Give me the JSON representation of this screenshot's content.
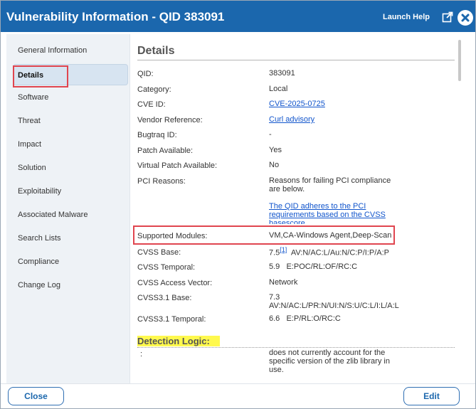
{
  "window": {
    "title": "Vulnerability Information - QID 383091",
    "launch_help": "Launch Help"
  },
  "sidebar": {
    "items": [
      {
        "label": "General Information"
      },
      {
        "label": "Details"
      },
      {
        "label": "Software"
      },
      {
        "label": "Threat"
      },
      {
        "label": "Impact"
      },
      {
        "label": "Solution"
      },
      {
        "label": "Exploitability"
      },
      {
        "label": "Associated Malware"
      },
      {
        "label": "Search Lists"
      },
      {
        "label": "Compliance"
      },
      {
        "label": "Change Log"
      }
    ],
    "selected": "Details"
  },
  "details": {
    "title": "Details",
    "rows": {
      "qid": {
        "label": "QID:",
        "value": "383091"
      },
      "category": {
        "label": "Category:",
        "value": "Local"
      },
      "cve_id": {
        "label": "CVE ID:",
        "value": "CVE-2025-0725"
      },
      "vendor_reference": {
        "label": "Vendor Reference:",
        "value": "Curl advisory"
      },
      "bugtraq_id": {
        "label": "Bugtraq ID:",
        "value": "-"
      },
      "patch_available": {
        "label": "Patch Available:",
        "value": "Yes"
      },
      "virtual_patch": {
        "label": "Virtual Patch Available:",
        "value": "No"
      },
      "pci_reasons": {
        "label": "PCI Reasons:",
        "value": "Reasons for failing PCI compliance are below.",
        "link": "The QID adheres to the PCI requirements based on the CVSS basescore."
      },
      "supported_modules": {
        "label": "Supported Modules:",
        "value": "VM,CA-Windows Agent,Deep-Scan"
      },
      "cvss_base": {
        "label": "CVSS Base:",
        "value": "7.5",
        "ref": "[1]",
        "vector": "AV:N/AC:L/Au:N/C:P/I:P/A:P"
      },
      "cvss_temporal": {
        "label": "CVSS Temporal:",
        "value": "5.9",
        "vector": "E:POC/RL:OF/RC:C"
      },
      "cvss_access_vector": {
        "label": "CVSS Access Vector:",
        "value": "Network"
      },
      "cvss31_base": {
        "label": "CVSS3.1 Base:",
        "value": "7.3",
        "vector": "AV:N/AC:L/PR:N/UI:N/S:U/C:L/I:L/A:L"
      },
      "cvss31_temporal": {
        "label": "CVSS3.1 Temporal:",
        "value": "6.6",
        "vector": "E:P/RL:O/RC:C"
      }
    }
  },
  "detection_logic": {
    "title": "Detection Logic:",
    "label": ":",
    "text": "does not currently account for the specific version of the zlib library in use."
  },
  "footer": {
    "close_label": "Close",
    "edit_label": "Edit"
  },
  "colors": {
    "titlebar": "#1b67ad",
    "highlight_box": "#e0454f",
    "yellow_highlight": "#fff94d",
    "link": "#1155cc"
  },
  "icons": {
    "popout": "popout-icon",
    "close": "close-icon"
  }
}
